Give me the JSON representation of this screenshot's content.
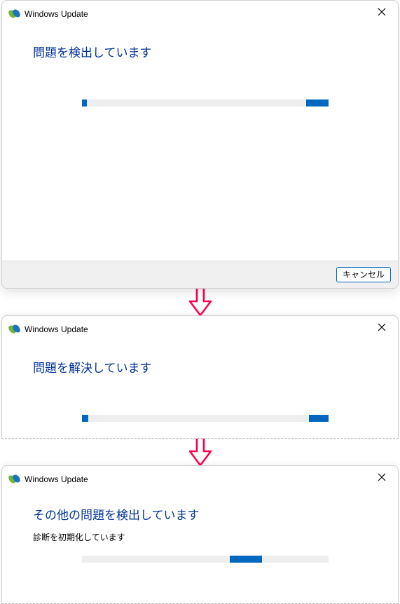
{
  "app": {
    "title": "Windows Update"
  },
  "colors": {
    "accent": "#0067c0",
    "headline": "#003399",
    "arrow": "#ff004c",
    "footer_bg": "#f0f0f0",
    "track": "#eeeeee"
  },
  "panels": [
    {
      "id": "panel-1",
      "headline": "問題を検出しています",
      "subtext": null,
      "progress_segments": [
        {
          "left_pct": 0,
          "width_pct": 2
        },
        {
          "left_pct": 91,
          "width_pct": 9
        }
      ],
      "cancel_label": "キャンセル",
      "has_footer": true
    },
    {
      "id": "panel-2",
      "headline": "問題を解決しています",
      "subtext": null,
      "progress_segments": [
        {
          "left_pct": 0,
          "width_pct": 2.5
        },
        {
          "left_pct": 92,
          "width_pct": 8
        }
      ],
      "has_footer": false
    },
    {
      "id": "panel-3",
      "headline": "その他の問題を検出しています",
      "subtext": "診断を初期化しています",
      "progress_segments": [
        {
          "left_pct": 60,
          "width_pct": 13
        }
      ],
      "has_footer": false
    }
  ]
}
